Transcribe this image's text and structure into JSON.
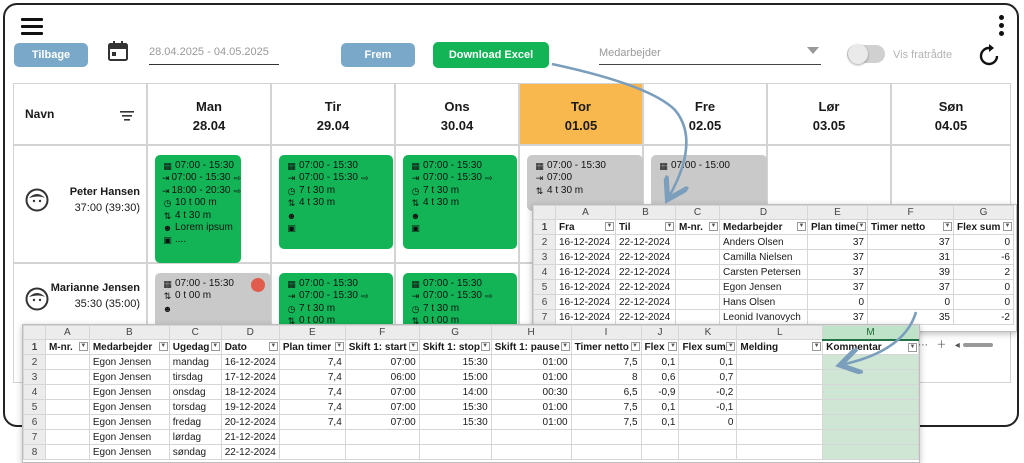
{
  "toolbar": {
    "back_label": "Tilbage",
    "date_range": "28.04.2025 - 04.05.2025",
    "forward_label": "Frem",
    "download_label": "Download Excel",
    "employee_placeholder": "Medarbejder",
    "show_resigned_label": "Vis fratrådte",
    "show_resigned_on": false
  },
  "colors": {
    "accent_blue": "#7aa8c8",
    "green": "#12b455",
    "today": "#f9b84d",
    "grey_shift": "#c9c9c9"
  },
  "schedule": {
    "name_header": "Navn",
    "days": [
      {
        "name": "Man",
        "date": "28.04"
      },
      {
        "name": "Tir",
        "date": "29.04"
      },
      {
        "name": "Ons",
        "date": "30.04"
      },
      {
        "name": "Tor",
        "date": "01.05"
      },
      {
        "name": "Fre",
        "date": "02.05"
      },
      {
        "name": "Lør",
        "date": "03.05"
      },
      {
        "name": "Søn",
        "date": "04.05"
      }
    ],
    "employees": [
      {
        "name": "Peter Hansen",
        "hours": "37:00 (39:30)"
      },
      {
        "name": "Marianne Jensen",
        "hours": "35:30 (35:00)"
      }
    ],
    "shifts": {
      "p_mon": [
        "07:00 - 15:30",
        "07:00 - 15:30",
        "18:00 - 20:30",
        "10 t 00 m",
        "4 t 30 m",
        "Lorem ipsum",
        "...."
      ],
      "p_tue": [
        "07:00 - 15:30",
        "07:00 - 15:30",
        "7 t 30 m",
        "4 t 30 m"
      ],
      "p_wed": [
        "07:00 - 15:30",
        "07:00 - 15:30",
        "7 t 30 m",
        "4 t 30 m"
      ],
      "p_thu": [
        "07:00 - 15:30",
        "07:00",
        "4 t 30 m"
      ],
      "p_fri": [
        "07:00 - 15:00"
      ],
      "m_mon": [
        "07:00 - 15:30",
        "0 t 00 m"
      ],
      "m_tue": [
        "07:00 - 15:30",
        "07:00 - 15:30",
        "7 t 30 m",
        "0 t 00 m"
      ],
      "m_wed": [
        "07:00 - 15:30",
        "07:00 - 15:30",
        "7 t 30 m",
        "0 t 00 m"
      ]
    }
  },
  "sheet_top": {
    "col_letters": [
      "A",
      "B",
      "C",
      "D",
      "E",
      "F",
      "G"
    ],
    "headers": [
      "Fra",
      "Til",
      "M-nr.",
      "Medarbejder",
      "Plan timer",
      "Timer netto",
      "Flex sum"
    ],
    "row_numbers": [
      "1",
      "2",
      "3",
      "4",
      "5",
      "6",
      "7"
    ],
    "rows": [
      [
        "16-12-2024",
        "22-12-2024",
        "",
        "Anders Olsen",
        "37",
        "37",
        "0"
      ],
      [
        "16-12-2024",
        "22-12-2024",
        "",
        "Camilla Nielsen",
        "37",
        "31",
        "-6"
      ],
      [
        "16-12-2024",
        "22-12-2024",
        "",
        "Carsten Petersen",
        "37",
        "39",
        "2"
      ],
      [
        "16-12-2024",
        "22-12-2024",
        "",
        "Egon Jensen",
        "37",
        "37",
        "0"
      ],
      [
        "16-12-2024",
        "22-12-2024",
        "",
        "Hans Olsen",
        "0",
        "0",
        "0"
      ],
      [
        "16-12-2024",
        "22-12-2024",
        "",
        "Leonid Ivanovych",
        "37",
        "35",
        "-2"
      ]
    ]
  },
  "sheet_bottom": {
    "col_letters": [
      "A",
      "B",
      "C",
      "D",
      "E",
      "F",
      "G",
      "H",
      "I",
      "J",
      "K",
      "L",
      "M"
    ],
    "headers": [
      "M-nr.",
      "Medarbejder",
      "Ugedag",
      "Dato",
      "Plan timer",
      "Skift 1: start",
      "Skift 1: stop",
      "Skift 1: pause",
      "Timer netto",
      "Flex",
      "Flex sum",
      "Melding",
      "Kommentar"
    ],
    "row_numbers": [
      "1",
      "2",
      "3",
      "4",
      "5",
      "6",
      "7",
      "8"
    ],
    "rows": [
      [
        "",
        "Egon Jensen",
        "mandag",
        "16-12-2024",
        "7,4",
        "07:00",
        "15:30",
        "01:00",
        "7,5",
        "0,1",
        "0,1",
        "",
        ""
      ],
      [
        "",
        "Egon Jensen",
        "tirsdag",
        "17-12-2024",
        "7,4",
        "06:00",
        "15:00",
        "01:00",
        "8",
        "0,6",
        "0,7",
        "",
        ""
      ],
      [
        "",
        "Egon Jensen",
        "onsdag",
        "18-12-2024",
        "7,4",
        "07:00",
        "14:00",
        "00:30",
        "6,5",
        "-0,9",
        "-0,2",
        "",
        ""
      ],
      [
        "",
        "Egon Jensen",
        "torsdag",
        "19-12-2024",
        "7,4",
        "07:00",
        "15:30",
        "01:00",
        "7,5",
        "0,1",
        "-0,1",
        "",
        ""
      ],
      [
        "",
        "Egon Jensen",
        "fredag",
        "20-12-2024",
        "7,4",
        "07:00",
        "15:30",
        "01:00",
        "7,5",
        "0,1",
        "0",
        "",
        ""
      ],
      [
        "",
        "Egon Jensen",
        "lørdag",
        "21-12-2024",
        "",
        "",
        "",
        "",
        "",
        "",
        "",
        "",
        ""
      ],
      [
        "",
        "Egon Jensen",
        "søndag",
        "22-12-2024",
        "",
        "",
        "",
        "",
        "",
        "",
        "",
        "",
        ""
      ]
    ]
  }
}
